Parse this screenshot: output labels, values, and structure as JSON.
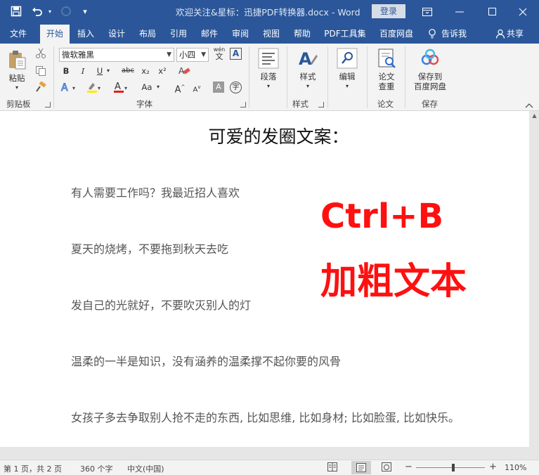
{
  "window": {
    "title": "欢迎关注&星标：迅捷PDF转换器.docx  -  Word",
    "login_label": "登录"
  },
  "tabs": [
    "文件",
    "开始",
    "插入",
    "设计",
    "布局",
    "引用",
    "邮件",
    "审阅",
    "视图",
    "帮助",
    "PDF工具集",
    "百度网盘"
  ],
  "tell_me": "告诉我",
  "share": "共享",
  "ribbon": {
    "clipboard": {
      "paste": "粘贴",
      "label": "剪贴板"
    },
    "font": {
      "name": "微软雅黑",
      "size": "小四",
      "label": "字体",
      "pinyin_top": "wén",
      "pinyin_bottom": "文",
      "bold": "B",
      "italic": "I",
      "underline": "U",
      "strike": "abc",
      "subscript": "x₂",
      "superscript": "x²",
      "case": "Aa",
      "grow": "A",
      "shrink": "A"
    },
    "paragraph": {
      "label": "段落"
    },
    "styles": {
      "label": "样式",
      "group": "样式"
    },
    "editing": {
      "label": "编辑"
    },
    "paper": {
      "label_line1": "论文",
      "label_line2": "查重",
      "group": "论文"
    },
    "save": {
      "label_line1": "保存到",
      "label_line2": "百度网盘",
      "group": "保存"
    }
  },
  "document": {
    "heading": "可爱的发圈文案：",
    "paragraphs": [
      "有人需要工作吗？我最近招人喜欢",
      "夏天的烧烤，不要拖到秋天去吃",
      "发自己的光就好，不要吹灭别人的灯",
      "温柔的一半是知识，没有涵养的温柔撑不起你要的风骨",
      "女孩子多去争取别人抢不走的东西, 比如思维, 比如身材; 比如脸蛋, 比如快乐。"
    ],
    "annotation_line1": "Ctrl+B",
    "annotation_line2": "加粗文本",
    "annotation_color": "#ff1010"
  },
  "status": {
    "page": "第 1 页，共 2 页",
    "words": "360 个字",
    "language": "中文(中国)",
    "zoom": "110%",
    "zoom_level_percent": 110
  },
  "colors": {
    "accent": "#2b579a"
  }
}
